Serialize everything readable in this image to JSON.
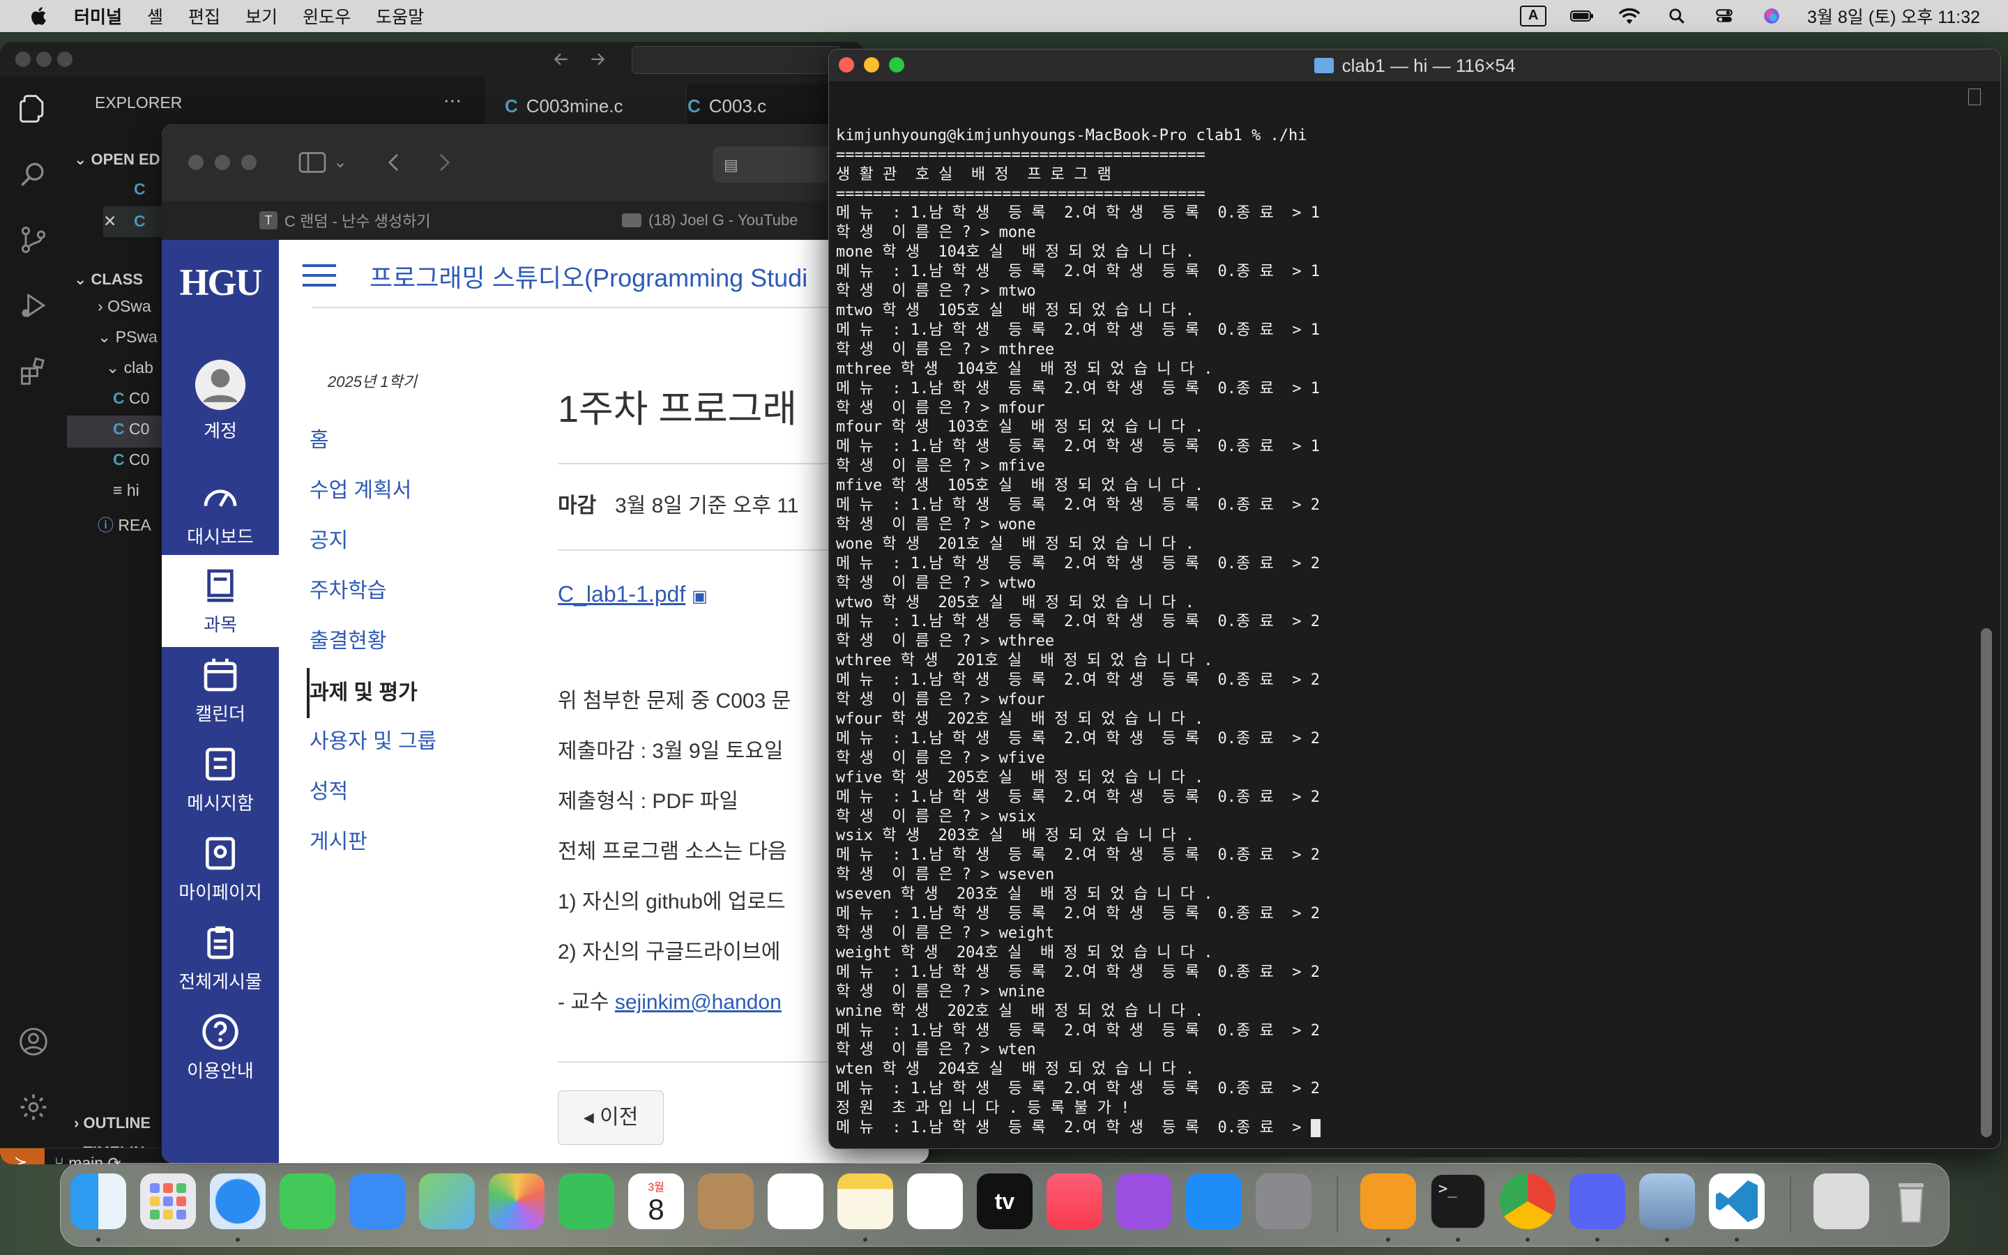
{
  "menubar": {
    "app": "터미널",
    "items": [
      "셸",
      "편집",
      "보기",
      "윈도우",
      "도움말"
    ],
    "input_mode": "A",
    "clock": "3월 8일 (토) 오후 11:32"
  },
  "vscode": {
    "explorer_title": "EXPLORER",
    "more": "···",
    "open_editors": "OPEN ED",
    "open_files": [
      "C",
      "C"
    ],
    "class_section": "CLASS",
    "tree": [
      "OSwa",
      "PSwa",
      "clab",
      "C0",
      "C0",
      "C0",
      "hi",
      "REA"
    ],
    "outline": "OUTLINE",
    "timeline": "TIMELIN",
    "tabs": [
      {
        "label": "C003mine.c"
      },
      {
        "label": "C003.c"
      }
    ],
    "branch": "main"
  },
  "browser": {
    "tabs": [
      "C 랜덤 - 난수 생성하기",
      "(18) Joel G - YouTube"
    ],
    "logo": "HGU",
    "global_nav": [
      "계정",
      "대시보드",
      "과목",
      "캘린더",
      "메시지함",
      "마이페이지",
      "전체게시물",
      "이용안내"
    ],
    "course_title": "프로그래밍 스튜디오(Programming Studi",
    "term": "2025년 1학기",
    "course_nav": [
      "홈",
      "수업 계획서",
      "공지",
      "주차학습",
      "출결현황",
      "과제 및 평가",
      "사용자 및 그룹",
      "성적",
      "게시판"
    ],
    "assignment_title": "1주차 프로그래",
    "due_label": "마감",
    "due_value": "3월 8일 기준 오후 11",
    "attachment": "C_lab1-1.pdf",
    "paragraphs": [
      "위 첨부한 문제 중 C003 문",
      "제출마감 : 3월 9일 토요일 ",
      "제출형식 : PDF 파일",
      "전체 프로그램 소스는 다음 ",
      "1) 자신의 github에 업로드",
      "2) 자신의 구글드라이브에 "
    ],
    "professor_prefix": " - 교수 ",
    "professor_email": "sejinkim@handon",
    "prev_button": "◂ 이전"
  },
  "terminal": {
    "title": "clab1 — hi — 116×54",
    "lines": [
      "kimjunhyoung@kimjunhyoungs-MacBook-Pro clab1 % ./hi",
      "========================================",
      "생 활 관  호 실  배 정  프 로 그 램",
      "========================================",
      "메 뉴  : 1.남 학 생  등 록  2.여 학 생  등 록  0.종 료  > 1",
      "학 생  이 름 은 ? > mone",
      "mone 학 생  104호 실  배 정 되 었 습 니 다 .",
      "메 뉴  : 1.남 학 생  등 록  2.여 학 생  등 록  0.종 료  > 1",
      "학 생  이 름 은 ? > mtwo",
      "mtwo 학 생  105호 실  배 정 되 었 습 니 다 .",
      "메 뉴  : 1.남 학 생  등 록  2.여 학 생  등 록  0.종 료  > 1",
      "학 생  이 름 은 ? > mthree",
      "mthree 학 생  104호 실  배 정 되 었 습 니 다 .",
      "메 뉴  : 1.남 학 생  등 록  2.여 학 생  등 록  0.종 료  > 1",
      "학 생  이 름 은 ? > mfour",
      "mfour 학 생  103호 실  배 정 되 었 습 니 다 .",
      "메 뉴  : 1.남 학 생  등 록  2.여 학 생  등 록  0.종 료  > 1",
      "학 생  이 름 은 ? > mfive",
      "mfive 학 생  105호 실  배 정 되 었 습 니 다 .",
      "메 뉴  : 1.남 학 생  등 록  2.여 학 생  등 록  0.종 료  > 2",
      "학 생  이 름 은 ? > wone",
      "wone 학 생  201호 실  배 정 되 었 습 니 다 .",
      "메 뉴  : 1.남 학 생  등 록  2.여 학 생  등 록  0.종 료  > 2",
      "학 생  이 름 은 ? > wtwo",
      "wtwo 학 생  205호 실  배 정 되 었 습 니 다 .",
      "메 뉴  : 1.남 학 생  등 록  2.여 학 생  등 록  0.종 료  > 2",
      "학 생  이 름 은 ? > wthree",
      "wthree 학 생  201호 실  배 정 되 었 습 니 다 .",
      "메 뉴  : 1.남 학 생  등 록  2.여 학 생  등 록  0.종 료  > 2",
      "학 생  이 름 은 ? > wfour",
      "wfour 학 생  202호 실  배 정 되 었 습 니 다 .",
      "메 뉴  : 1.남 학 생  등 록  2.여 학 생  등 록  0.종 료  > 2",
      "학 생  이 름 은 ? > wfive",
      "wfive 학 생  205호 실  배 정 되 었 습 니 다 .",
      "메 뉴  : 1.남 학 생  등 록  2.여 학 생  등 록  0.종 료  > 2",
      "학 생  이 름 은 ? > wsix",
      "wsix 학 생  203호 실  배 정 되 었 습 니 다 .",
      "메 뉴  : 1.남 학 생  등 록  2.여 학 생  등 록  0.종 료  > 2",
      "학 생  이 름 은 ? > wseven",
      "wseven 학 생  203호 실  배 정 되 었 습 니 다 .",
      "메 뉴  : 1.남 학 생  등 록  2.여 학 생  등 록  0.종 료  > 2",
      "학 생  이 름 은 ? > weight",
      "weight 학 생  204호 실  배 정 되 었 습 니 다 .",
      "메 뉴  : 1.남 학 생  등 록  2.여 학 생  등 록  0.종 료  > 2",
      "학 생  이 름 은 ? > wnine",
      "wnine 학 생  202호 실  배 정 되 었 습 니 다 .",
      "메 뉴  : 1.남 학 생  등 록  2.여 학 생  등 록  0.종 료  > 2",
      "학 생  이 름 은 ? > wten",
      "wten 학 생  204호 실  배 정 되 었 습 니 다 .",
      "메 뉴  : 1.남 학 생  등 록  2.여 학 생  등 록  0.종 료  > 2",
      "정 원  초 과 입 니 다 . 등 록 불 가 !",
      "메 뉴  : 1.남 학 생  등 록  2.여 학 생  등 록  0.종 료  > "
    ]
  },
  "dock": {
    "calendar_month": "3월",
    "calendar_day": "8",
    "apps": [
      "finder-icon",
      "launchpad-icon",
      "safari-icon",
      "messages-icon",
      "mail-icon",
      "maps-icon",
      "photos-icon",
      "facetime-icon",
      "calendar-icon",
      "contacts-icon",
      "reminders-icon",
      "notes-icon",
      "freeform-icon",
      "tv-icon",
      "music-icon",
      "podcasts-icon",
      "appstore-icon",
      "settings-icon",
      "books-icon",
      "terminal-icon",
      "chrome-icon",
      "discord-icon",
      "preview-icon",
      "vscode-icon",
      "downloads-icon",
      "trash-icon"
    ],
    "tv_label": "tv"
  },
  "colors": {
    "canvas_nav": "#2d3b8c",
    "link": "#2d5ab5",
    "terminal_bg": "#1c1c1c",
    "vscode_bg": "#1f1f1f"
  }
}
